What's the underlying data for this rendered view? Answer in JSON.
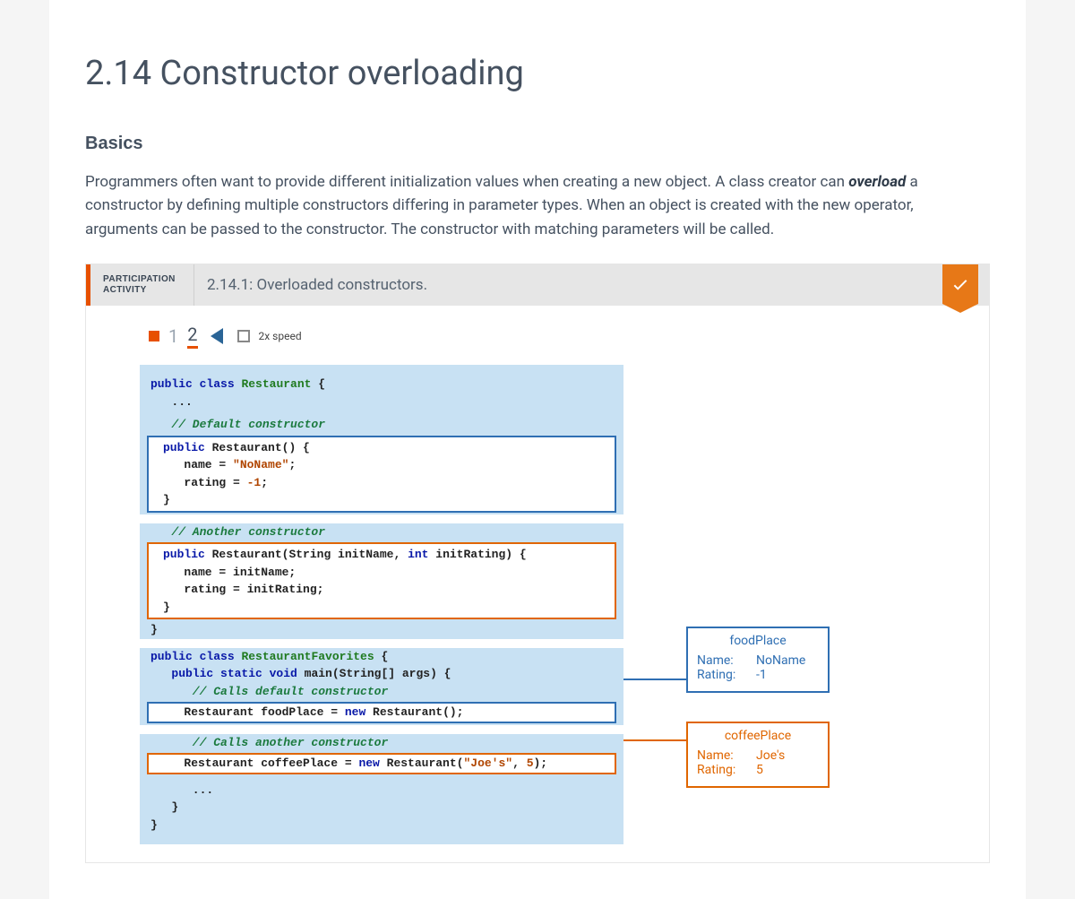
{
  "page": {
    "title": "2.14 Constructor overloading",
    "subhead": "Basics",
    "intro_before": "Programmers often want to provide different initialization values when creating a new object. A class creator can ",
    "intro_term": "overload",
    "intro_after": " a constructor by defining multiple constructors differing in parameter types. When an object is created with the new operator, arguments can be passed to the constructor. The constructor with matching parameters will be called."
  },
  "activity": {
    "label_line1": "PARTICIPATION",
    "label_line2": "ACTIVITY",
    "title": "2.14.1: Overloaded constructors.",
    "completed": true,
    "controls": {
      "step1": "1",
      "step2": "2",
      "speed_label": "2x speed"
    }
  },
  "code": {
    "class_decl_kw": "public class",
    "class_name1": "Restaurant",
    "brace_open": " {",
    "ellipsis": "   ...",
    "cmt_default": "   // Default constructor",
    "ctor1_sig": "   public Restaurant() {",
    "ctor1_l1": "      name = \"NoName\";",
    "ctor1_l2": "      rating = -1;",
    "ctor1_close": "   }",
    "cmt_another": "   // Another constructor",
    "ctor2_sig": "   public Restaurant(String initName, int initRating) {",
    "ctor2_l1": "      name = initName;",
    "ctor2_l2": "      rating = initRating;",
    "ctor2_close": "   }",
    "class1_close": "}",
    "class_name2": "RestaurantFavorites",
    "main_sig": "   public static void main(String[] args) {",
    "cmt_calls_default": "      // Calls default constructor",
    "food_line": "      Restaurant foodPlace = new Restaurant();",
    "cmt_calls_another": "      // Calls another constructor",
    "coffee_line": "      Restaurant coffeePlace = new Restaurant(\"Joe's\", 5);",
    "main_ellipsis": "      ...",
    "main_close": "   }",
    "class2_close": "}"
  },
  "objects": {
    "food": {
      "title": "foodPlace",
      "name_label": "Name:",
      "name_val": "NoName",
      "rating_label": "Rating:",
      "rating_val": "-1"
    },
    "coffee": {
      "title": "coffeePlace",
      "name_label": "Name:",
      "name_val": "Joe's",
      "rating_label": "Rating:",
      "rating_val": "5"
    }
  }
}
